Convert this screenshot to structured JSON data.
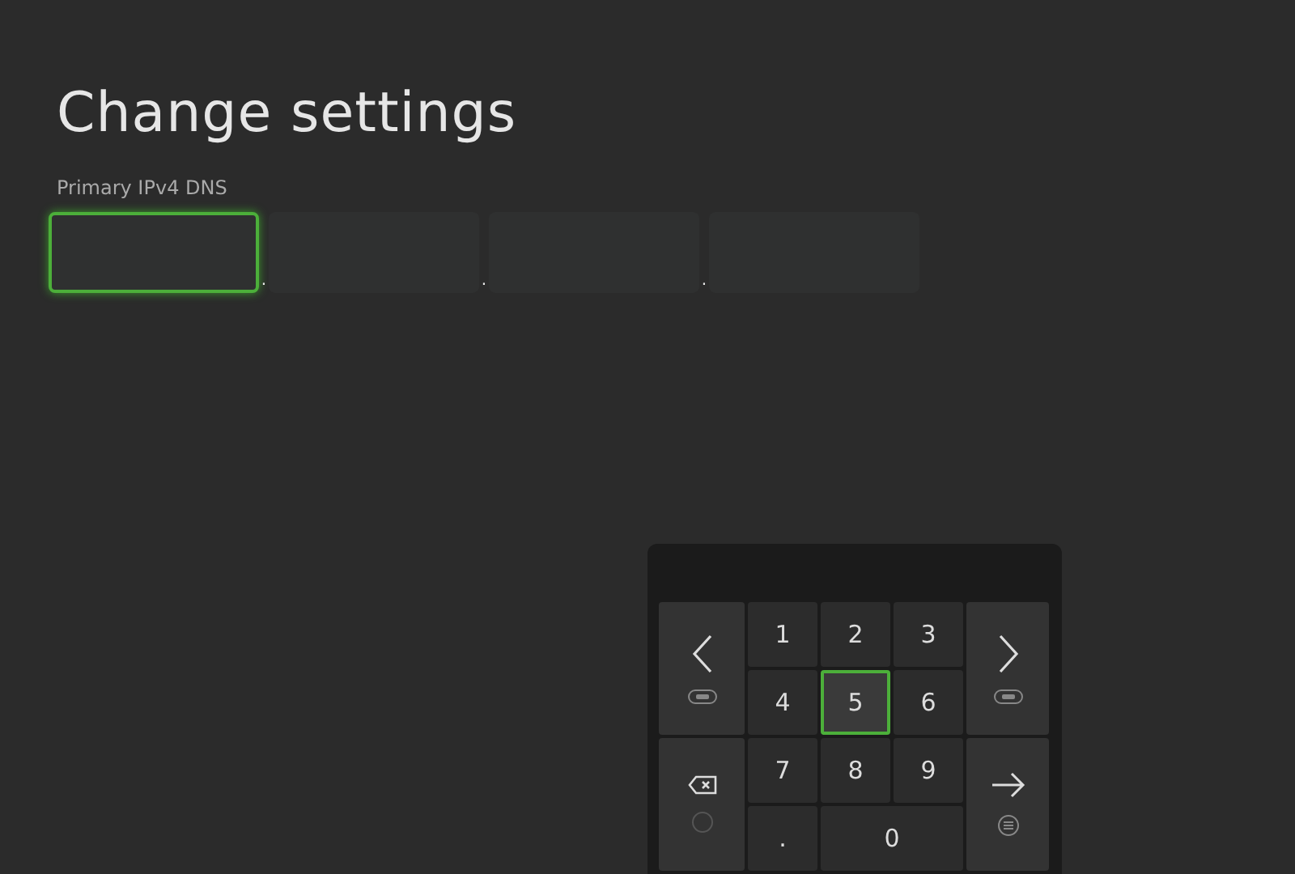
{
  "title": "Change settings",
  "field_label": "Primary IPv4 DNS",
  "octets": [
    {
      "selected": true
    },
    {
      "selected": false
    },
    {
      "selected": false
    },
    {
      "selected": false
    }
  ],
  "separator": ".",
  "keypad": {
    "keys": [
      {
        "kind": "back",
        "selected": false
      },
      {
        "kind": "digit",
        "label": "1",
        "selected": false
      },
      {
        "kind": "digit",
        "label": "2",
        "selected": false
      },
      {
        "kind": "digit",
        "label": "3",
        "selected": false
      },
      {
        "kind": "forward",
        "selected": false
      },
      {
        "kind": "digit",
        "label": "4",
        "selected": false
      },
      {
        "kind": "digit",
        "label": "5",
        "selected": true
      },
      {
        "kind": "digit",
        "label": "6",
        "selected": false
      },
      {
        "kind": "delete",
        "selected": false
      },
      {
        "kind": "digit",
        "label": "7",
        "selected": false
      },
      {
        "kind": "digit",
        "label": "8",
        "selected": false
      },
      {
        "kind": "digit",
        "label": "9",
        "selected": false
      },
      {
        "kind": "enter",
        "selected": false
      },
      {
        "kind": "digit",
        "label": ".",
        "selected": false
      },
      {
        "kind": "wide-digit",
        "label": "0",
        "selected": false
      }
    ]
  }
}
